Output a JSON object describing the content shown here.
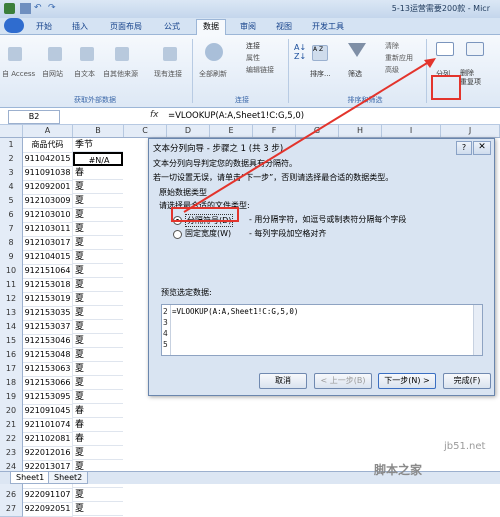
{
  "window": {
    "title": "5-13运营需要200款 - Micr"
  },
  "tabs": [
    "开始",
    "插入",
    "页面布局",
    "公式",
    "数据",
    "审阅",
    "视图",
    "开发工具"
  ],
  "active_tab": "数据",
  "ribbon": {
    "external": {
      "items": [
        "自 Access",
        "自网站",
        "自文本",
        "自其他来源",
        "现有连接"
      ],
      "group": "获取外部数据"
    },
    "connections": {
      "refresh": "全部刷新",
      "items": [
        "连接",
        "属性",
        "编辑链接"
      ],
      "group": "连接"
    },
    "sort": {
      "sort_label": "排序...",
      "filter_label": "筛选",
      "items": [
        "清除",
        "重新应用",
        "高级"
      ],
      "group": "排序和筛选"
    },
    "tools": {
      "items": [
        "分列",
        "删除\n重复项"
      ]
    }
  },
  "formula_bar": {
    "namebox": "B2",
    "fx": "fx",
    "formula": "=VLOOKUP(A:A,Sheet1!C:G,5,0)"
  },
  "columns": [
    "A",
    "B",
    "C",
    "D",
    "E",
    "F",
    "G",
    "H",
    "I",
    "J"
  ],
  "rows": [
    {
      "n": "1",
      "a": "商品代码",
      "b": "季节"
    },
    {
      "n": "2",
      "a": "911042015",
      "b": "#N/A"
    },
    {
      "n": "3",
      "a": "911091038",
      "b": "春"
    },
    {
      "n": "4",
      "a": "912092001",
      "b": "夏"
    },
    {
      "n": "5",
      "a": "912103009",
      "b": "夏"
    },
    {
      "n": "6",
      "a": "912103010",
      "b": "夏"
    },
    {
      "n": "7",
      "a": "912103011",
      "b": "夏"
    },
    {
      "n": "8",
      "a": "912103017",
      "b": "夏"
    },
    {
      "n": "9",
      "a": "912104015",
      "b": "夏"
    },
    {
      "n": "10",
      "a": "912151064",
      "b": "夏"
    },
    {
      "n": "11",
      "a": "912153018",
      "b": "夏"
    },
    {
      "n": "12",
      "a": "912153019",
      "b": "夏"
    },
    {
      "n": "13",
      "a": "912153035",
      "b": "夏"
    },
    {
      "n": "14",
      "a": "912153037",
      "b": "夏"
    },
    {
      "n": "15",
      "a": "912153046",
      "b": "夏"
    },
    {
      "n": "16",
      "a": "912153048",
      "b": "夏"
    },
    {
      "n": "17",
      "a": "912153063",
      "b": "夏"
    },
    {
      "n": "18",
      "a": "912153066",
      "b": "夏"
    },
    {
      "n": "19",
      "a": "912153095",
      "b": "夏"
    },
    {
      "n": "20",
      "a": "921091045",
      "b": "春"
    },
    {
      "n": "21",
      "a": "921101074",
      "b": "春"
    },
    {
      "n": "22",
      "a": "921102081",
      "b": "春"
    },
    {
      "n": "23",
      "a": "922012016",
      "b": "夏"
    },
    {
      "n": "24",
      "a": "922013017",
      "b": "夏"
    },
    {
      "n": "25",
      "a": "922091058",
      "b": "夏"
    },
    {
      "n": "26",
      "a": "922091107",
      "b": "夏"
    },
    {
      "n": "27",
      "a": "922092051",
      "b": "夏"
    }
  ],
  "sheet_tabs": [
    "Sheet1",
    "Sheet2"
  ],
  "dialog": {
    "title": "文本分列向导 - 步骤之 1 (共 3 步)",
    "help": "?",
    "close": "✕",
    "line1": "文本分列向导判定您的数据具有分隔符。",
    "line2": "若一切设置无误，请单击“下一步”，否则请选择最合适的数据类型。",
    "orig_group": "原始数据类型",
    "choose": "请选择最合适的文件类型:",
    "opt1": "分隔符号(D)",
    "opt1_desc": "- 用分隔字符，如逗号或制表符分隔每个字段",
    "opt2": "固定宽度(W)",
    "opt2_desc": "- 每列字段加空格对齐",
    "preview_label": "预览选定数据:",
    "preview_rows": [
      "2",
      "3",
      "4",
      "5"
    ],
    "preview_text": "=VLOOKUP(A:A,Sheet1!C:G,5,0)",
    "buttons": {
      "cancel": "取消",
      "back": "< 上一步(B)",
      "next": "下一步(N) >",
      "finish": "完成(F)"
    }
  },
  "watermark": {
    "site": "jb51.net",
    "text": "脚本之家"
  },
  "colors": {
    "accent": "#e3342c",
    "ribbon": "#dde8f5"
  }
}
